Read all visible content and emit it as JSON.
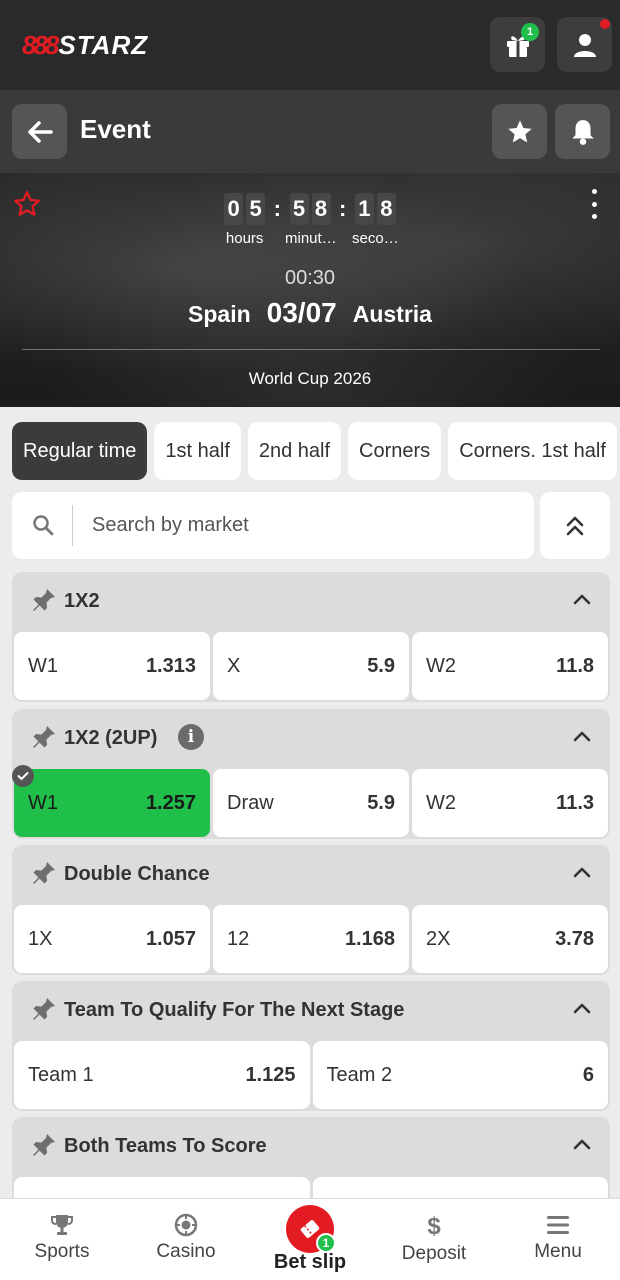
{
  "brand": {
    "logo_mark": "888",
    "logo_text": "STARZ"
  },
  "topbar": {
    "gift_badge": "1"
  },
  "header": {
    "title": "Event"
  },
  "event": {
    "countdown": {
      "hours": [
        "0",
        "5"
      ],
      "minutes": [
        "5",
        "8"
      ],
      "seconds": [
        "1",
        "8"
      ],
      "hours_label": "hours",
      "minutes_label": "minut…",
      "seconds_label": "seco…",
      "separator": ":"
    },
    "kickoff_time": "00:30",
    "home_team": "Spain",
    "date": "03/07",
    "away_team": "Austria",
    "tournament": "World Cup 2026"
  },
  "tabs": [
    {
      "label": "Regular time",
      "active": true
    },
    {
      "label": "1st half",
      "active": false
    },
    {
      "label": "2nd half",
      "active": false
    },
    {
      "label": "Corners",
      "active": false
    },
    {
      "label": "Corners. 1st half",
      "active": false
    }
  ],
  "search": {
    "placeholder": "Search by market"
  },
  "markets": [
    {
      "title": "1X2",
      "odds": [
        {
          "label": "W1",
          "value": "1.313"
        },
        {
          "label": "X",
          "value": "5.9"
        },
        {
          "label": "W2",
          "value": "11.8"
        }
      ]
    },
    {
      "title": "1X2 (2UP)",
      "info": "i",
      "odds": [
        {
          "label": "W1",
          "value": "1.257",
          "selected": true
        },
        {
          "label": "Draw",
          "value": "5.9"
        },
        {
          "label": "W2",
          "value": "11.3"
        }
      ]
    },
    {
      "title": "Double Chance",
      "odds": [
        {
          "label": "1X",
          "value": "1.057"
        },
        {
          "label": "12",
          "value": "1.168"
        },
        {
          "label": "2X",
          "value": "3.78"
        }
      ]
    },
    {
      "title": "Team To Qualify For The Next Stage",
      "odds": [
        {
          "label": "Team 1",
          "value": "1.125"
        },
        {
          "label": "Team 2",
          "value": "6"
        }
      ]
    },
    {
      "title": "Both Teams To Score"
    }
  ],
  "bottom_nav": {
    "sports": "Sports",
    "casino": "Casino",
    "betslip": "Bet slip",
    "betslip_count": "1",
    "deposit": "Deposit",
    "menu": "Menu"
  },
  "colors": {
    "accent_red": "#e31b23",
    "selected_green": "#1fbf4a",
    "dark": "#2a2a2a"
  }
}
